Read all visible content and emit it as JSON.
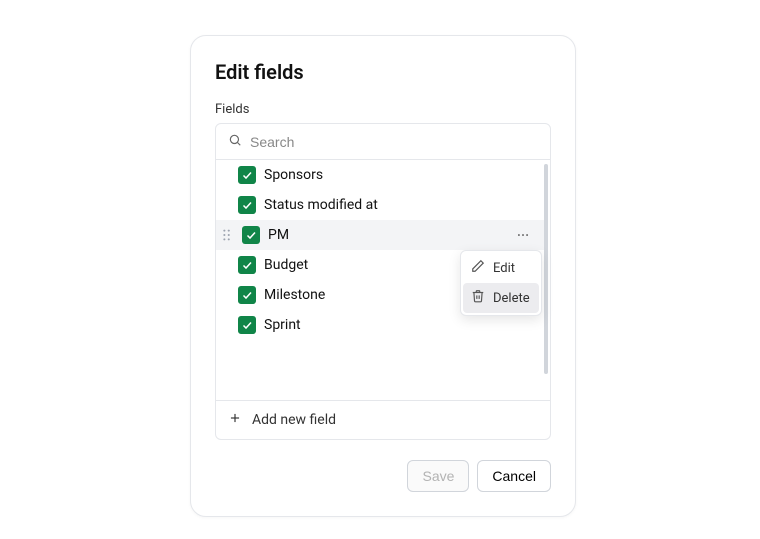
{
  "dialog": {
    "title": "Edit fields",
    "section_label": "Fields",
    "search_placeholder": "Search",
    "fields": [
      {
        "label": "Sponsors"
      },
      {
        "label": "Status modified at"
      },
      {
        "label": "PM"
      },
      {
        "label": "Budget"
      },
      {
        "label": "Milestone"
      },
      {
        "label": "Sprint"
      }
    ],
    "menu": {
      "edit": "Edit",
      "delete": "Delete"
    },
    "add_new": "Add new field",
    "save": "Save",
    "cancel": "Cancel"
  }
}
